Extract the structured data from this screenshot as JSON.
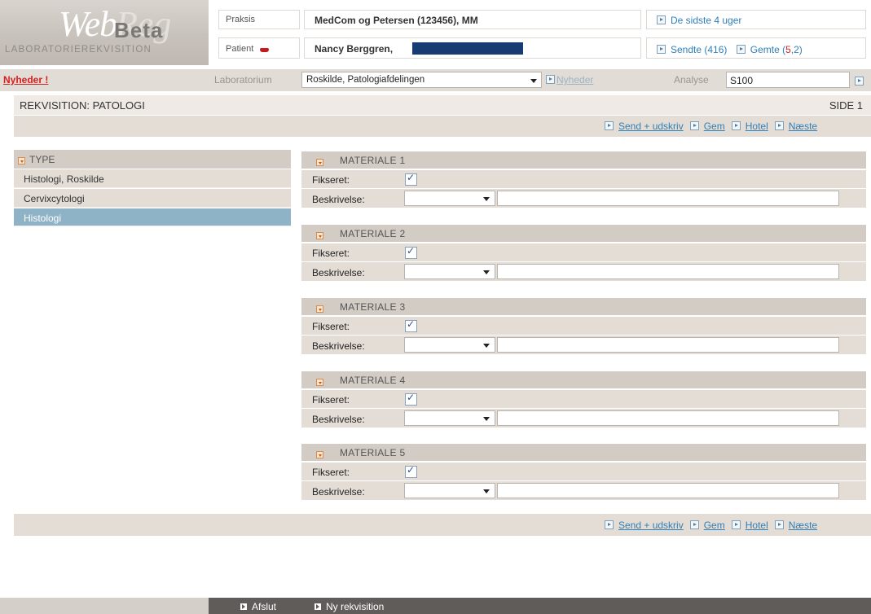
{
  "logo": {
    "web": "Web",
    "reg": "Reg",
    "beta": "Beta",
    "subtitle": "LABORATORIEREKVISITION"
  },
  "header": {
    "praksis_label": "Praksis",
    "praksis_value": "MedCom og Petersen (123456), MM",
    "patient_label": "Patient",
    "patient_value": "Nancy Berggren,",
    "link_last4": "De sidste 4 uger",
    "link_sent": "Sendte (416)",
    "link_saved_prefix": "Gemte (",
    "link_saved_count1": "5",
    "link_saved_sep": ",",
    "link_saved_count2": "2",
    "link_saved_suffix": ")"
  },
  "toolbar": {
    "news": "Nyheder !",
    "lab_label": "Laboratorium",
    "lab_value": "Roskilde, Patologiafdelingen",
    "lab_news": "Nyheder",
    "analyse_label": "Analyse",
    "analyse_value": "S100"
  },
  "page": {
    "title": "REKVISITION: PATOLOGI",
    "side": "SIDE 1"
  },
  "actions": {
    "send": "Send + udskriv",
    "save": "Gem",
    "hotel": "Hotel",
    "next": "Næste"
  },
  "type_panel": {
    "header": "TYPE",
    "items": [
      "Histologi, Roskilde",
      "Cervixcytologi",
      "Histologi"
    ],
    "selected_index": 2
  },
  "materials": [
    {
      "title": "MATERIALE 1",
      "fixed_label": "Fikseret:",
      "fixed": true,
      "desc_label": "Beskrivelse:"
    },
    {
      "title": "MATERIALE 2",
      "fixed_label": "Fikseret:",
      "fixed": true,
      "desc_label": "Beskrivelse:"
    },
    {
      "title": "MATERIALE 3",
      "fixed_label": "Fikseret:",
      "fixed": true,
      "desc_label": "Beskrivelse:"
    },
    {
      "title": "MATERIALE 4",
      "fixed_label": "Fikseret:",
      "fixed": true,
      "desc_label": "Beskrivelse:"
    },
    {
      "title": "MATERIALE 5",
      "fixed_label": "Fikseret:",
      "fixed": true,
      "desc_label": "Beskrivelse:"
    }
  ],
  "footer": {
    "exit": "Afslut",
    "new": "Ny rekvisition"
  }
}
